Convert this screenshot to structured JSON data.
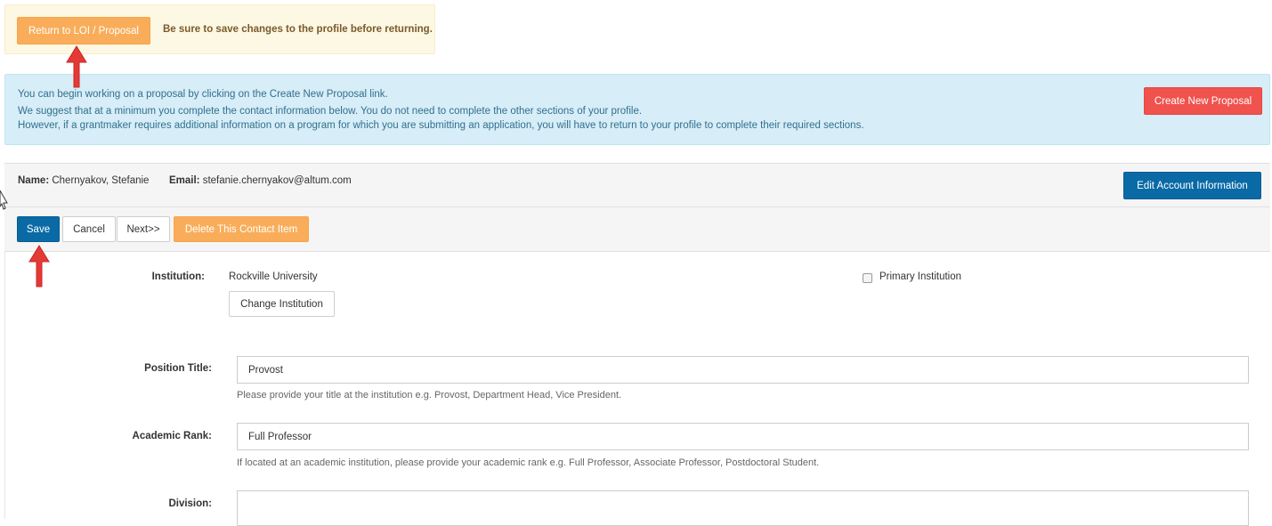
{
  "notice": {
    "return_label": "Return to LOI / Proposal",
    "message": "Be sure to save changes to the profile before returning."
  },
  "info": {
    "lines": [
      "You can begin working on a proposal by clicking on the Create New Proposal link.",
      "We suggest that at a minimum you complete the contact information below. You do not need to complete the other sections of your profile.",
      "However, if a grantmaker requires additional information on a program for which you are submitting an application, you will have to return to your profile to complete their required sections."
    ],
    "create_label": "Create New Proposal"
  },
  "account": {
    "name_label": "Name:",
    "name_value": "Chernyakov, Stefanie",
    "email_label": "Email:",
    "email_value": "stefanie.chernyakov@altum.com",
    "edit_label": "Edit Account Information"
  },
  "toolbar": {
    "save_label": "Save",
    "cancel_label": "Cancel",
    "next_label": "Next>>",
    "delete_label": "Delete This Contact Item"
  },
  "form": {
    "institution_label": "Institution:",
    "institution_value": "Rockville University",
    "change_institution_label": "Change Institution",
    "primary_institution_label": "Primary Institution",
    "position_label": "Position Title:",
    "position_value": "Provost",
    "position_help": "Please provide your title at the institution e.g. Provost, Department Head, Vice President.",
    "rank_label": "Academic Rank:",
    "rank_value": "Full Professor",
    "rank_help": "If located at an academic institution, please provide your academic rank e.g. Full Professor, Associate Professor, Postdoctoral Student.",
    "division_label": "Division:",
    "division_value": ""
  },
  "colors": {
    "accent_orange": "#f9ad5a",
    "accent_red": "#f0524d",
    "accent_blue": "#0a6aa6",
    "annotation_arrow": "#e53935"
  }
}
